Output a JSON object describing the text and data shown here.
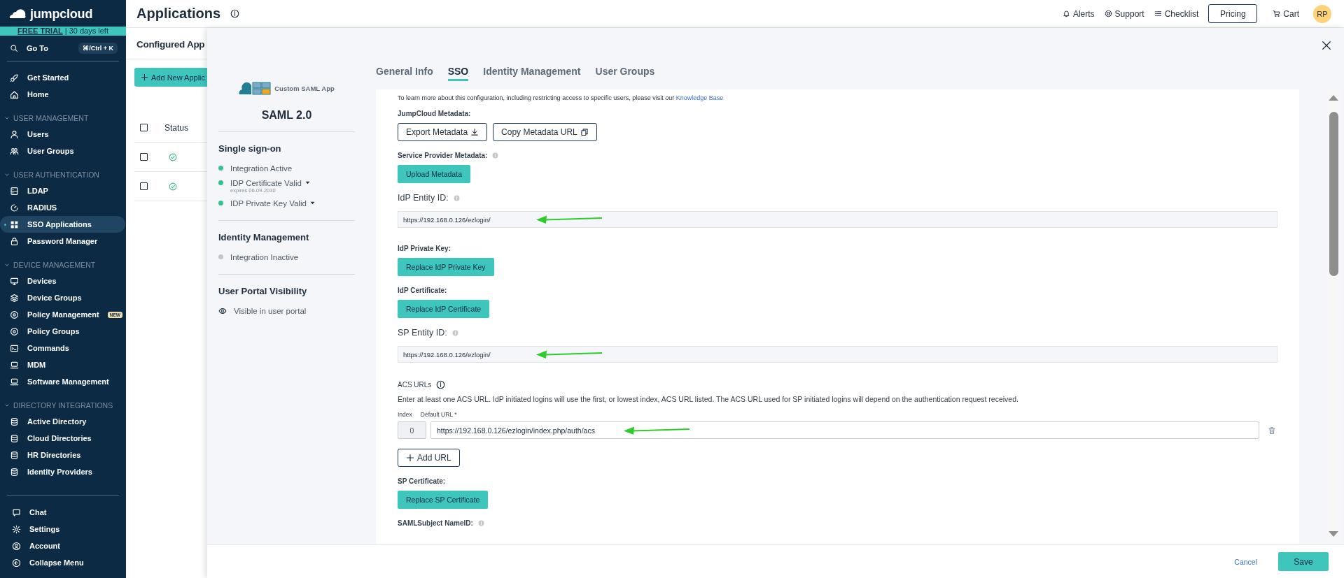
{
  "sidebar": {
    "logo": "jumpcloud",
    "trial": {
      "label": "FREE TRIAL",
      "text": "| 30 days left"
    },
    "goto": {
      "label": "Go To",
      "shortcut": "⌘/Ctrl + K"
    },
    "items": [
      {
        "label": "Get Started",
        "selected": false
      },
      {
        "label": "Home",
        "selected": false
      }
    ],
    "sections": [
      {
        "title": "USER MANAGEMENT",
        "expanded": true,
        "items": [
          {
            "label": "Users",
            "selected": false
          },
          {
            "label": "User Groups",
            "selected": false
          }
        ]
      },
      {
        "title": "USER AUTHENTICATION",
        "expanded": true,
        "items": [
          {
            "label": "LDAP",
            "selected": false
          },
          {
            "label": "RADIUS",
            "selected": false
          },
          {
            "label": "SSO Applications",
            "selected": true
          },
          {
            "label": "Password Manager",
            "selected": false
          }
        ]
      },
      {
        "title": "DEVICE MANAGEMENT",
        "expanded": true,
        "items": [
          {
            "label": "Devices",
            "selected": false
          },
          {
            "label": "Device Groups",
            "selected": false
          },
          {
            "label": "Policy Management",
            "selected": false,
            "badge": "NEW"
          },
          {
            "label": "Policy Groups",
            "selected": false
          },
          {
            "label": "Commands",
            "selected": false
          },
          {
            "label": "MDM",
            "selected": false
          },
          {
            "label": "Software Management",
            "selected": false
          }
        ]
      },
      {
        "title": "DIRECTORY INTEGRATIONS",
        "expanded": true,
        "items": [
          {
            "label": "Active Directory",
            "selected": false
          },
          {
            "label": "Cloud Directories",
            "selected": false
          },
          {
            "label": "HR Directories",
            "selected": false
          },
          {
            "label": "Identity Providers",
            "selected": false
          }
        ]
      }
    ],
    "bottom": [
      {
        "label": "Chat"
      },
      {
        "label": "Settings"
      },
      {
        "label": "Account"
      },
      {
        "label": "Collapse Menu"
      }
    ]
  },
  "topbar": {
    "title": "Applications",
    "actions": [
      {
        "label": "Alerts"
      },
      {
        "label": "Support"
      },
      {
        "label": "Checklist"
      }
    ],
    "pricing": "Pricing",
    "cart": "Cart",
    "avatar": "RP"
  },
  "page": {
    "heading": "Configured App",
    "add_button": "Add New Applic",
    "table": {
      "all_checked": false,
      "columns": [
        "Status"
      ],
      "rows": [
        {
          "checked": false
        },
        {
          "checked": false
        }
      ]
    }
  },
  "modal": {
    "app_logo": "Custom SAML App",
    "protocol": "SAML 2.0",
    "summary": [
      {
        "title": "Single sign-on",
        "items": [
          {
            "label": "Integration Active",
            "kind": "active",
            "dropdown": false
          },
          {
            "label": "IDP Certificate Valid",
            "kind": "active",
            "dropdown": true,
            "note": "expires 06-09-2030"
          },
          {
            "label": "IDP Private Key Valid",
            "kind": "active",
            "dropdown": true
          }
        ]
      },
      {
        "title": "Identity Management",
        "items": [
          {
            "label": "Integration Inactive",
            "kind": "inactive",
            "dropdown": false
          }
        ]
      },
      {
        "title": "User Portal Visibility",
        "items": [
          {
            "label": "Visible in user portal",
            "kind": "visible",
            "dropdown": false
          }
        ]
      }
    ],
    "tabs": [
      {
        "label": "General Info",
        "selected": false
      },
      {
        "label": "SSO",
        "selected": true
      },
      {
        "label": "Identity Management",
        "selected": false
      },
      {
        "label": "User Groups",
        "selected": false
      }
    ],
    "form": [
      {
        "kind": "note",
        "text": "To learn more about this configuration, including restricting access to specific users, please visit our",
        "link": "Knowledge Base"
      },
      {
        "kind": "buttons",
        "label": "JumpCloud Metadata:",
        "info": false,
        "buttons": [
          "Export Metadata",
          "Copy Metadata URL"
        ]
      },
      {
        "kind": "button",
        "label": "Service Provider Metadata:",
        "info": true,
        "button": "Upload Metadata"
      },
      {
        "kind": "text",
        "label": "IdP Entity ID:",
        "info": true,
        "value": "https://192.168.0.126/ezlogin/",
        "annotated": true
      },
      {
        "kind": "button",
        "label": "IdP Private Key:",
        "info": false,
        "button": "Replace IdP Private Key"
      },
      {
        "kind": "button",
        "label": "IdP Certificate:",
        "info": false,
        "button": "Replace IdP Certificate"
      },
      {
        "kind": "text",
        "label": "SP Entity ID:",
        "info": true,
        "value": "https://192.168.0.126/ezlogin/",
        "annotated": true
      },
      {
        "kind": "acs",
        "label": "ACS URLs",
        "info": true,
        "description": "Enter at least one ACS URL. IdP initiated logins will use the first, or lowest index, ACS URL listed. The ACS URL used for SP initiated logins will depend on the authentication request received.",
        "index_label": "Index",
        "url_label": "Default URL *",
        "rows": [
          {
            "index": "0",
            "url": "https://192.168.0.126/ezlogin/index.php/auth/acs",
            "annotated": true
          }
        ],
        "add_button": "Add URL"
      },
      {
        "kind": "button",
        "label": "SP Certificate:",
        "info": false,
        "button": "Replace SP Certificate"
      },
      {
        "kind": "heading",
        "label": "SAMLSubject NameID:",
        "info": true
      }
    ],
    "footer": {
      "cancel": "Cancel",
      "save": "Save"
    }
  }
}
